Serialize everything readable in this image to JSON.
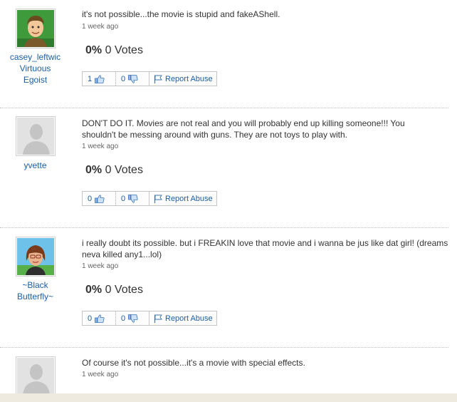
{
  "answers": [
    {
      "user_lines": [
        "casey_leftwic",
        "Virtuous",
        "Egoist"
      ],
      "avatar": "cartoon-boy-avatar",
      "text": "it's not possible...the movie is stupid and fakeAShell.",
      "time": "1 week ago",
      "vote_pct": "0%",
      "vote_count": "0 Votes",
      "thumbs_up": "1",
      "thumbs_down": "0",
      "report": "Report Abuse"
    },
    {
      "user_lines": [
        "yvette"
      ],
      "avatar": "default-silhouette-avatar",
      "text": "DON'T DO IT. Movies are not real and you will probably end up killing someone!!! You shouldn't be messing around with guns. They are not toys to play with.",
      "time": "1 week ago",
      "vote_pct": "0%",
      "vote_count": "0 Votes",
      "thumbs_up": "0",
      "thumbs_down": "0",
      "report": "Report Abuse"
    },
    {
      "user_lines": [
        "~Black",
        "Butterfly~"
      ],
      "avatar": "cartoon-girl-avatar",
      "text": "i really doubt its possible. but i FREAKIN love that movie and i wanna be jus like dat girl! (dreams neva killed any1...lol)",
      "time": "1 week ago",
      "vote_pct": "0%",
      "vote_count": "0 Votes",
      "thumbs_up": "0",
      "thumbs_down": "0",
      "report": "Report Abuse"
    },
    {
      "user_lines": [],
      "avatar": "default-silhouette-avatar",
      "text": "Of course it's not possible...it's a movie with special effects.",
      "time": "1 week ago"
    }
  ],
  "colors": {
    "link": "#1b5faa",
    "text": "#333333",
    "muted": "#666666",
    "footer": "#eeeae0"
  }
}
